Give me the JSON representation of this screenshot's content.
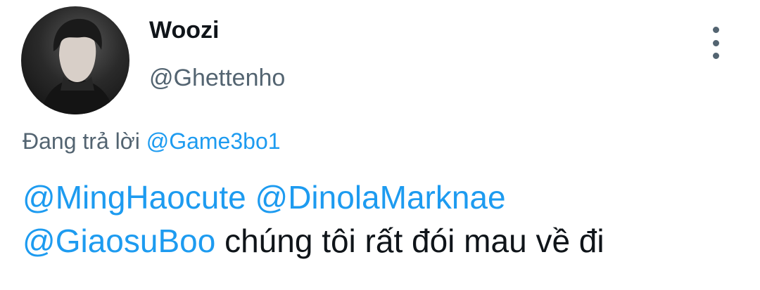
{
  "author": {
    "display_name": "Woozi",
    "handle": "@Ghettenho",
    "avatar_icon": "user-avatar"
  },
  "menu": {
    "icon": "more-vertical-icon"
  },
  "reply_context": {
    "prefix": "Đang trả lời",
    "mention": "@Game3bo1"
  },
  "tweet": {
    "mentions": [
      "@MingHaocute",
      "@DinolaMarknae",
      "@GiaosuBoo"
    ],
    "text": "chúng tôi rất đói mau về đi"
  },
  "colors": {
    "link": "#1d9bf0",
    "secondary_text": "#536471",
    "primary_text": "#0f1419"
  }
}
